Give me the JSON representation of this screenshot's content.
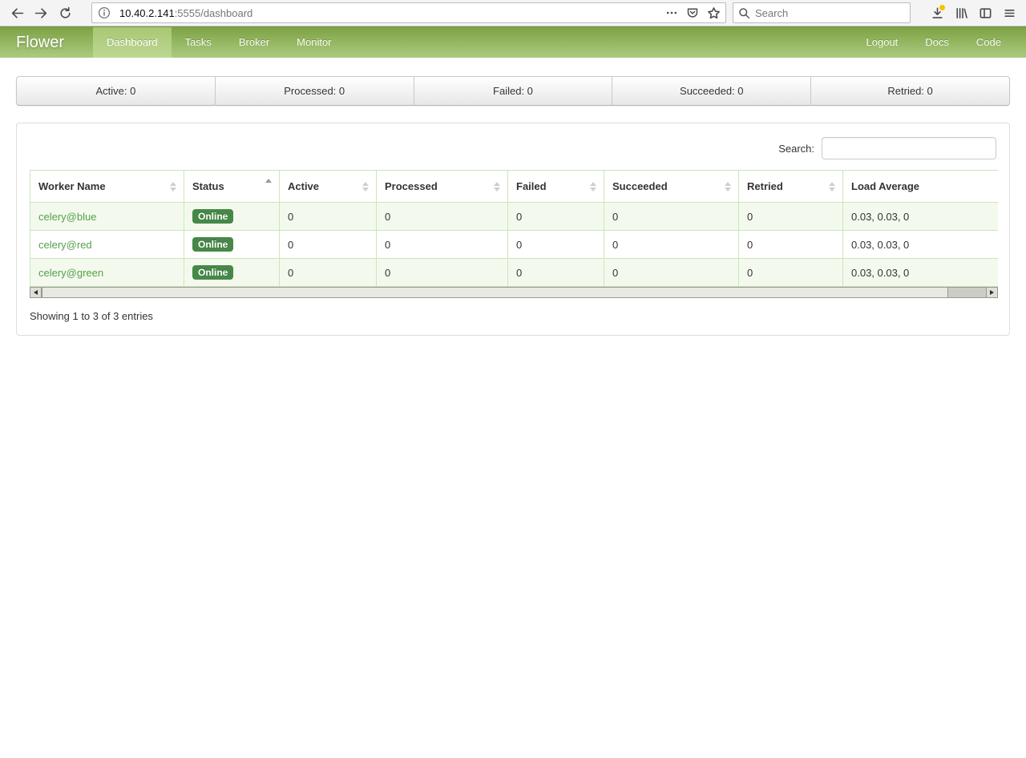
{
  "browser": {
    "url_host": "10.40.2.141",
    "url_path": ":5555/dashboard",
    "search_placeholder": "Search"
  },
  "navbar": {
    "brand": "Flower",
    "items": [
      {
        "label": "Dashboard",
        "active": true
      },
      {
        "label": "Tasks",
        "active": false
      },
      {
        "label": "Broker",
        "active": false
      },
      {
        "label": "Monitor",
        "active": false
      }
    ],
    "right_items": [
      {
        "label": "Logout"
      },
      {
        "label": "Docs"
      },
      {
        "label": "Code"
      }
    ]
  },
  "stats": [
    {
      "label": "Active: 0"
    },
    {
      "label": "Processed: 0"
    },
    {
      "label": "Failed: 0"
    },
    {
      "label": "Succeeded: 0"
    },
    {
      "label": "Retried: 0"
    }
  ],
  "panel": {
    "search_label": "Search:",
    "search_value": "",
    "table": {
      "columns": [
        {
          "label": "Worker Name",
          "sort": "none"
        },
        {
          "label": "Status",
          "sort": "asc"
        },
        {
          "label": "Active",
          "sort": "none"
        },
        {
          "label": "Processed",
          "sort": "none"
        },
        {
          "label": "Failed",
          "sort": "none"
        },
        {
          "label": "Succeeded",
          "sort": "none"
        },
        {
          "label": "Retried",
          "sort": "none"
        },
        {
          "label": "Load Average",
          "sort": "none"
        }
      ],
      "rows": [
        {
          "worker": "celery@blue",
          "status": "Online",
          "active": "0",
          "processed": "0",
          "failed": "0",
          "succeeded": "0",
          "retried": "0",
          "load_average": "0.03, 0.03, 0"
        },
        {
          "worker": "celery@red",
          "status": "Online",
          "active": "0",
          "processed": "0",
          "failed": "0",
          "succeeded": "0",
          "retried": "0",
          "load_average": "0.03, 0.03, 0"
        },
        {
          "worker": "celery@green",
          "status": "Online",
          "active": "0",
          "processed": "0",
          "failed": "0",
          "succeeded": "0",
          "retried": "0",
          "load_average": "0.03, 0.03, 0"
        }
      ],
      "info": "Showing 1 to 3 of 3 entries"
    }
  },
  "colors": {
    "navbar_top": "#7da244",
    "navbar_bottom": "#accb7f",
    "badge_success": "#468847",
    "worker_link": "#54a04a",
    "row_stripe": "#f3faed",
    "table_border": "#cbe6bc",
    "download_badge": "#ffbf00"
  }
}
